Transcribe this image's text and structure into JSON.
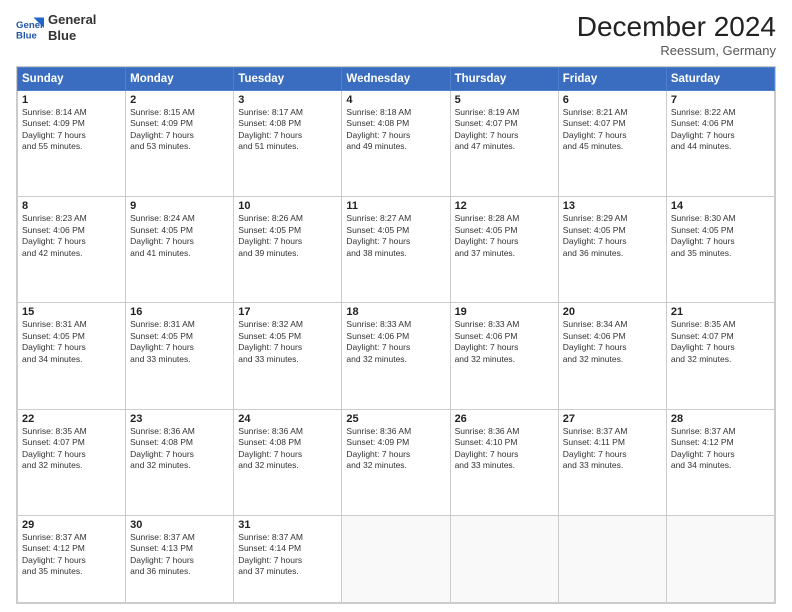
{
  "header": {
    "logo_line1": "General",
    "logo_line2": "Blue",
    "month": "December 2024",
    "location": "Reessum, Germany"
  },
  "weekdays": [
    "Sunday",
    "Monday",
    "Tuesday",
    "Wednesday",
    "Thursday",
    "Friday",
    "Saturday"
  ],
  "weeks": [
    [
      {
        "day": "1",
        "lines": [
          "Sunrise: 8:14 AM",
          "Sunset: 4:09 PM",
          "Daylight: 7 hours",
          "and 55 minutes."
        ]
      },
      {
        "day": "2",
        "lines": [
          "Sunrise: 8:15 AM",
          "Sunset: 4:09 PM",
          "Daylight: 7 hours",
          "and 53 minutes."
        ]
      },
      {
        "day": "3",
        "lines": [
          "Sunrise: 8:17 AM",
          "Sunset: 4:08 PM",
          "Daylight: 7 hours",
          "and 51 minutes."
        ]
      },
      {
        "day": "4",
        "lines": [
          "Sunrise: 8:18 AM",
          "Sunset: 4:08 PM",
          "Daylight: 7 hours",
          "and 49 minutes."
        ]
      },
      {
        "day": "5",
        "lines": [
          "Sunrise: 8:19 AM",
          "Sunset: 4:07 PM",
          "Daylight: 7 hours",
          "and 47 minutes."
        ]
      },
      {
        "day": "6",
        "lines": [
          "Sunrise: 8:21 AM",
          "Sunset: 4:07 PM",
          "Daylight: 7 hours",
          "and 45 minutes."
        ]
      },
      {
        "day": "7",
        "lines": [
          "Sunrise: 8:22 AM",
          "Sunset: 4:06 PM",
          "Daylight: 7 hours",
          "and 44 minutes."
        ]
      }
    ],
    [
      {
        "day": "8",
        "lines": [
          "Sunrise: 8:23 AM",
          "Sunset: 4:06 PM",
          "Daylight: 7 hours",
          "and 42 minutes."
        ]
      },
      {
        "day": "9",
        "lines": [
          "Sunrise: 8:24 AM",
          "Sunset: 4:05 PM",
          "Daylight: 7 hours",
          "and 41 minutes."
        ]
      },
      {
        "day": "10",
        "lines": [
          "Sunrise: 8:26 AM",
          "Sunset: 4:05 PM",
          "Daylight: 7 hours",
          "and 39 minutes."
        ]
      },
      {
        "day": "11",
        "lines": [
          "Sunrise: 8:27 AM",
          "Sunset: 4:05 PM",
          "Daylight: 7 hours",
          "and 38 minutes."
        ]
      },
      {
        "day": "12",
        "lines": [
          "Sunrise: 8:28 AM",
          "Sunset: 4:05 PM",
          "Daylight: 7 hours",
          "and 37 minutes."
        ]
      },
      {
        "day": "13",
        "lines": [
          "Sunrise: 8:29 AM",
          "Sunset: 4:05 PM",
          "Daylight: 7 hours",
          "and 36 minutes."
        ]
      },
      {
        "day": "14",
        "lines": [
          "Sunrise: 8:30 AM",
          "Sunset: 4:05 PM",
          "Daylight: 7 hours",
          "and 35 minutes."
        ]
      }
    ],
    [
      {
        "day": "15",
        "lines": [
          "Sunrise: 8:31 AM",
          "Sunset: 4:05 PM",
          "Daylight: 7 hours",
          "and 34 minutes."
        ]
      },
      {
        "day": "16",
        "lines": [
          "Sunrise: 8:31 AM",
          "Sunset: 4:05 PM",
          "Daylight: 7 hours",
          "and 33 minutes."
        ]
      },
      {
        "day": "17",
        "lines": [
          "Sunrise: 8:32 AM",
          "Sunset: 4:05 PM",
          "Daylight: 7 hours",
          "and 33 minutes."
        ]
      },
      {
        "day": "18",
        "lines": [
          "Sunrise: 8:33 AM",
          "Sunset: 4:06 PM",
          "Daylight: 7 hours",
          "and 32 minutes."
        ]
      },
      {
        "day": "19",
        "lines": [
          "Sunrise: 8:33 AM",
          "Sunset: 4:06 PM",
          "Daylight: 7 hours",
          "and 32 minutes."
        ]
      },
      {
        "day": "20",
        "lines": [
          "Sunrise: 8:34 AM",
          "Sunset: 4:06 PM",
          "Daylight: 7 hours",
          "and 32 minutes."
        ]
      },
      {
        "day": "21",
        "lines": [
          "Sunrise: 8:35 AM",
          "Sunset: 4:07 PM",
          "Daylight: 7 hours",
          "and 32 minutes."
        ]
      }
    ],
    [
      {
        "day": "22",
        "lines": [
          "Sunrise: 8:35 AM",
          "Sunset: 4:07 PM",
          "Daylight: 7 hours",
          "and 32 minutes."
        ]
      },
      {
        "day": "23",
        "lines": [
          "Sunrise: 8:36 AM",
          "Sunset: 4:08 PM",
          "Daylight: 7 hours",
          "and 32 minutes."
        ]
      },
      {
        "day": "24",
        "lines": [
          "Sunrise: 8:36 AM",
          "Sunset: 4:08 PM",
          "Daylight: 7 hours",
          "and 32 minutes."
        ]
      },
      {
        "day": "25",
        "lines": [
          "Sunrise: 8:36 AM",
          "Sunset: 4:09 PM",
          "Daylight: 7 hours",
          "and 32 minutes."
        ]
      },
      {
        "day": "26",
        "lines": [
          "Sunrise: 8:36 AM",
          "Sunset: 4:10 PM",
          "Daylight: 7 hours",
          "and 33 minutes."
        ]
      },
      {
        "day": "27",
        "lines": [
          "Sunrise: 8:37 AM",
          "Sunset: 4:11 PM",
          "Daylight: 7 hours",
          "and 33 minutes."
        ]
      },
      {
        "day": "28",
        "lines": [
          "Sunrise: 8:37 AM",
          "Sunset: 4:12 PM",
          "Daylight: 7 hours",
          "and 34 minutes."
        ]
      }
    ],
    [
      {
        "day": "29",
        "lines": [
          "Sunrise: 8:37 AM",
          "Sunset: 4:12 PM",
          "Daylight: 7 hours",
          "and 35 minutes."
        ]
      },
      {
        "day": "30",
        "lines": [
          "Sunrise: 8:37 AM",
          "Sunset: 4:13 PM",
          "Daylight: 7 hours",
          "and 36 minutes."
        ]
      },
      {
        "day": "31",
        "lines": [
          "Sunrise: 8:37 AM",
          "Sunset: 4:14 PM",
          "Daylight: 7 hours",
          "and 37 minutes."
        ]
      },
      null,
      null,
      null,
      null
    ]
  ]
}
